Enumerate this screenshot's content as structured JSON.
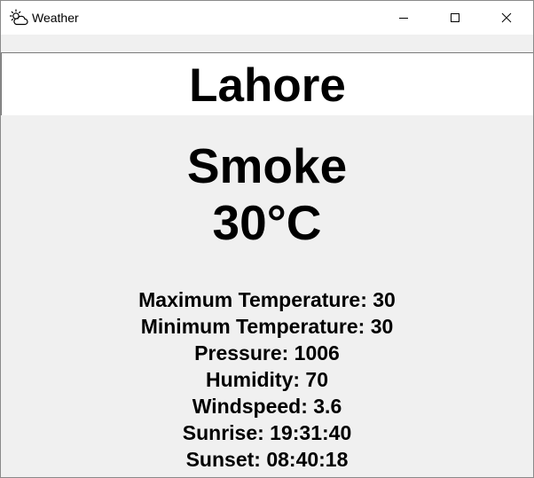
{
  "window": {
    "title": "Weather",
    "icon": "cloud-sun-icon"
  },
  "search": {
    "city_value": "Lahore"
  },
  "weather": {
    "condition": "Smoke",
    "temperature": "30°C"
  },
  "details": [
    {
      "text": "Maximum Temperature: 30"
    },
    {
      "text": "Minimum Temperature: 30"
    },
    {
      "text": "Pressure: 1006"
    },
    {
      "text": "Humidity: 70"
    },
    {
      "text": "Windspeed: 3.6"
    },
    {
      "text": "Sunrise: 19:31:40"
    },
    {
      "text": "Sunset: 08:40:18"
    }
  ]
}
